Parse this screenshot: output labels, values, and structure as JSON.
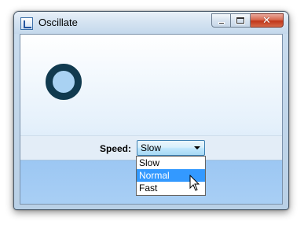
{
  "window": {
    "title": "Oscillate",
    "app_icon": "window-app-icon",
    "controls": [
      "minimize-icon",
      "maximize-icon",
      "close-icon"
    ]
  },
  "content": {
    "ring": {
      "color": "#113a4f",
      "fill": "#a9d2f3"
    },
    "speed": {
      "label": "Speed:",
      "selected": "Slow",
      "options": [
        "Slow",
        "Normal",
        "Fast"
      ],
      "highlighted_option": "Normal"
    }
  },
  "colors": {
    "highlight": "#3399ff",
    "bottom_band": "#9cc7f3"
  }
}
